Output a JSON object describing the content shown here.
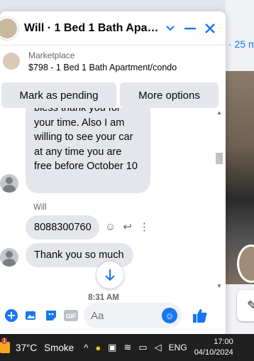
{
  "background": {
    "link_text": "· 25 m"
  },
  "chat": {
    "title": "Will · 1 Bed 1 Bath Apartm...",
    "listing": {
      "category": "Marketplace",
      "description": "$798 - 1 Bed 1 Bath Apartment/condo"
    },
    "actions": {
      "mark_pending": "Mark as pending",
      "more_options": "More options"
    },
    "messages": {
      "first_text": "bless thank you for your time. Also I am willing to see your car at any time you are free before October 10",
      "sender": "Will",
      "phone": "8088300760",
      "third_text": "Thank you so much",
      "timestamp": "8:31 AM"
    },
    "composer": {
      "placeholder": "Aa"
    },
    "accent_color": "#1877f2"
  },
  "taskbar": {
    "badge": "1",
    "temperature": "37°C",
    "condition": "Smoke",
    "language": "ENG",
    "time": "17:00",
    "date": "04/10/2024"
  }
}
